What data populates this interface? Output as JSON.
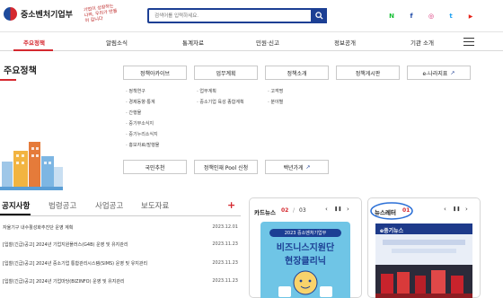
{
  "header": {
    "org_name": "중소벤처기업부",
    "slogan": "기업이 성장하는 나라, 우리가 만들어 갑니다",
    "search_placeholder": "검색어를 입력하세요.",
    "social": [
      {
        "icon": "naver-icon",
        "glyph": "N",
        "color": "#19c037"
      },
      {
        "icon": "facebook-icon",
        "glyph": "f",
        "color": "#1f4aa8"
      },
      {
        "icon": "instagram-icon",
        "glyph": "◎",
        "color": "#d6246e"
      },
      {
        "icon": "twitter-icon",
        "glyph": "t",
        "color": "#1da1f2"
      },
      {
        "icon": "youtube-icon",
        "glyph": "▶",
        "color": "#e62117"
      }
    ]
  },
  "nav": {
    "items": [
      "주요정책",
      "알림소식",
      "통계자료",
      "민원·신고",
      "정보공개",
      "기관 소개"
    ]
  },
  "policy": {
    "title": "주요정책",
    "buttons_row1": [
      "정책아카이브",
      "업무계획",
      "정책소개",
      "정책게시판",
      "e-나라지표"
    ],
    "buttons_row2": [
      "국민추천",
      "정책인재 Pool 신청",
      "백년가게"
    ],
    "links_col1": [
      "정책연구",
      "경제동향·통계",
      "간행물",
      "중기부소식지",
      "중기누리소식지",
      "홍보자료/발행물"
    ],
    "links_col2": [
      "업무계획",
      "중소기업 육성 종합계획"
    ],
    "links_col3": [
      "고객명",
      "분야별"
    ]
  },
  "notice": {
    "tabs": [
      "공지사항",
      "법령공고",
      "사업공고",
      "보도자료"
    ],
    "rows": [
      {
        "title": "자율기구 내수활성화추진단 운영 계획",
        "date": "2023.12.01"
      },
      {
        "title": "[입찰(긴급)공고] 2024년 기업지원플러스(G4B) 운영 및 유지관리",
        "date": "2023.11.23"
      },
      {
        "title": "[입찰(긴급)공고] 2024년 중소기업 통합관리시스템(SIMS) 운영 및 유지관리",
        "date": "2023.11.23"
      },
      {
        "title": "[입찰(긴급)공고] 2024년 기업마당(BIZINFO) 운영 및 유지관리",
        "date": "2023.11.23"
      }
    ]
  },
  "cardnews": {
    "title": "카드뉴스",
    "current": "02",
    "total": "03",
    "image_line1": "2023 중소벤처기업부",
    "image_line2": "비즈니스지원단",
    "image_line3": "현장클리닉"
  },
  "newsletter": {
    "title": "뉴스레터",
    "current": "01",
    "image_header": "e중기뉴스"
  },
  "controls": {
    "prev": "‹",
    "pause": "❚❚",
    "next": "›",
    "plus": "+"
  },
  "colors": {
    "brand_blue": "#1c3f94",
    "accent_red": "#d5282f",
    "annotation_blue": "#2a6fd6"
  }
}
